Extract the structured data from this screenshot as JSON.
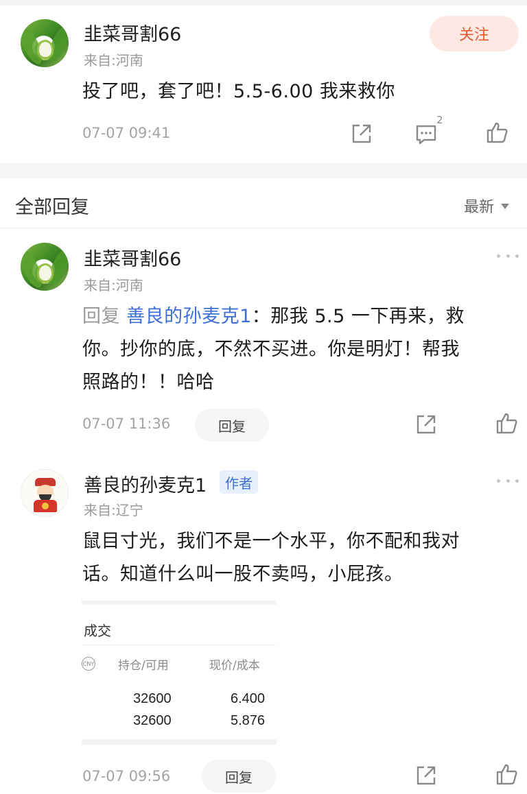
{
  "first_post": {
    "username": "韭菜哥割66",
    "location": "来自:河南",
    "follow_label": "关注",
    "text": "投了吧，套了吧！5.5-6.00 我来救你",
    "time": "07-07 09:41",
    "comment_count": "2",
    "icons": [
      "share-icon",
      "comment-icon",
      "like-icon"
    ]
  },
  "replies_header": {
    "title": "全部回复",
    "sort_label": "最新"
  },
  "replies": [
    {
      "username": "韭菜哥割66",
      "location": "来自:河南",
      "reply_prefix": "回复",
      "mention": "善良的孙麦克1",
      "text_line1": "：那我 5.5 一下再来，救",
      "text_line2": "你。抄你的底，不然不买进。你是明灯！帮我",
      "text_line3": "照路的！！哈哈",
      "time": "07-07 11:36",
      "reply_button": "回复"
    },
    {
      "username": "善良的孙麦克1",
      "author_badge": "作者",
      "location": "来自:辽宁",
      "text_line1": "鼠目寸光，我们不是一个水平，你不配和我对",
      "text_line2": "话。知道什么叫一股不卖吗，小屁孩。",
      "time": "07-07 09:56",
      "reply_button": "回复",
      "trade_card": {
        "title": "成交",
        "currency_icon_text": "CNY",
        "col1_header": "持仓/可用",
        "col2_header": "现价/成本",
        "rows": [
          {
            "holding": "32600",
            "price": "6.400"
          },
          {
            "holding": "32600",
            "price": "5.876"
          }
        ]
      }
    }
  ],
  "colors": {
    "follow_bg": "#fde9e3",
    "follow_text": "#e65a2d",
    "mention": "#3d6fd6",
    "muted": "#9a9a9a"
  }
}
